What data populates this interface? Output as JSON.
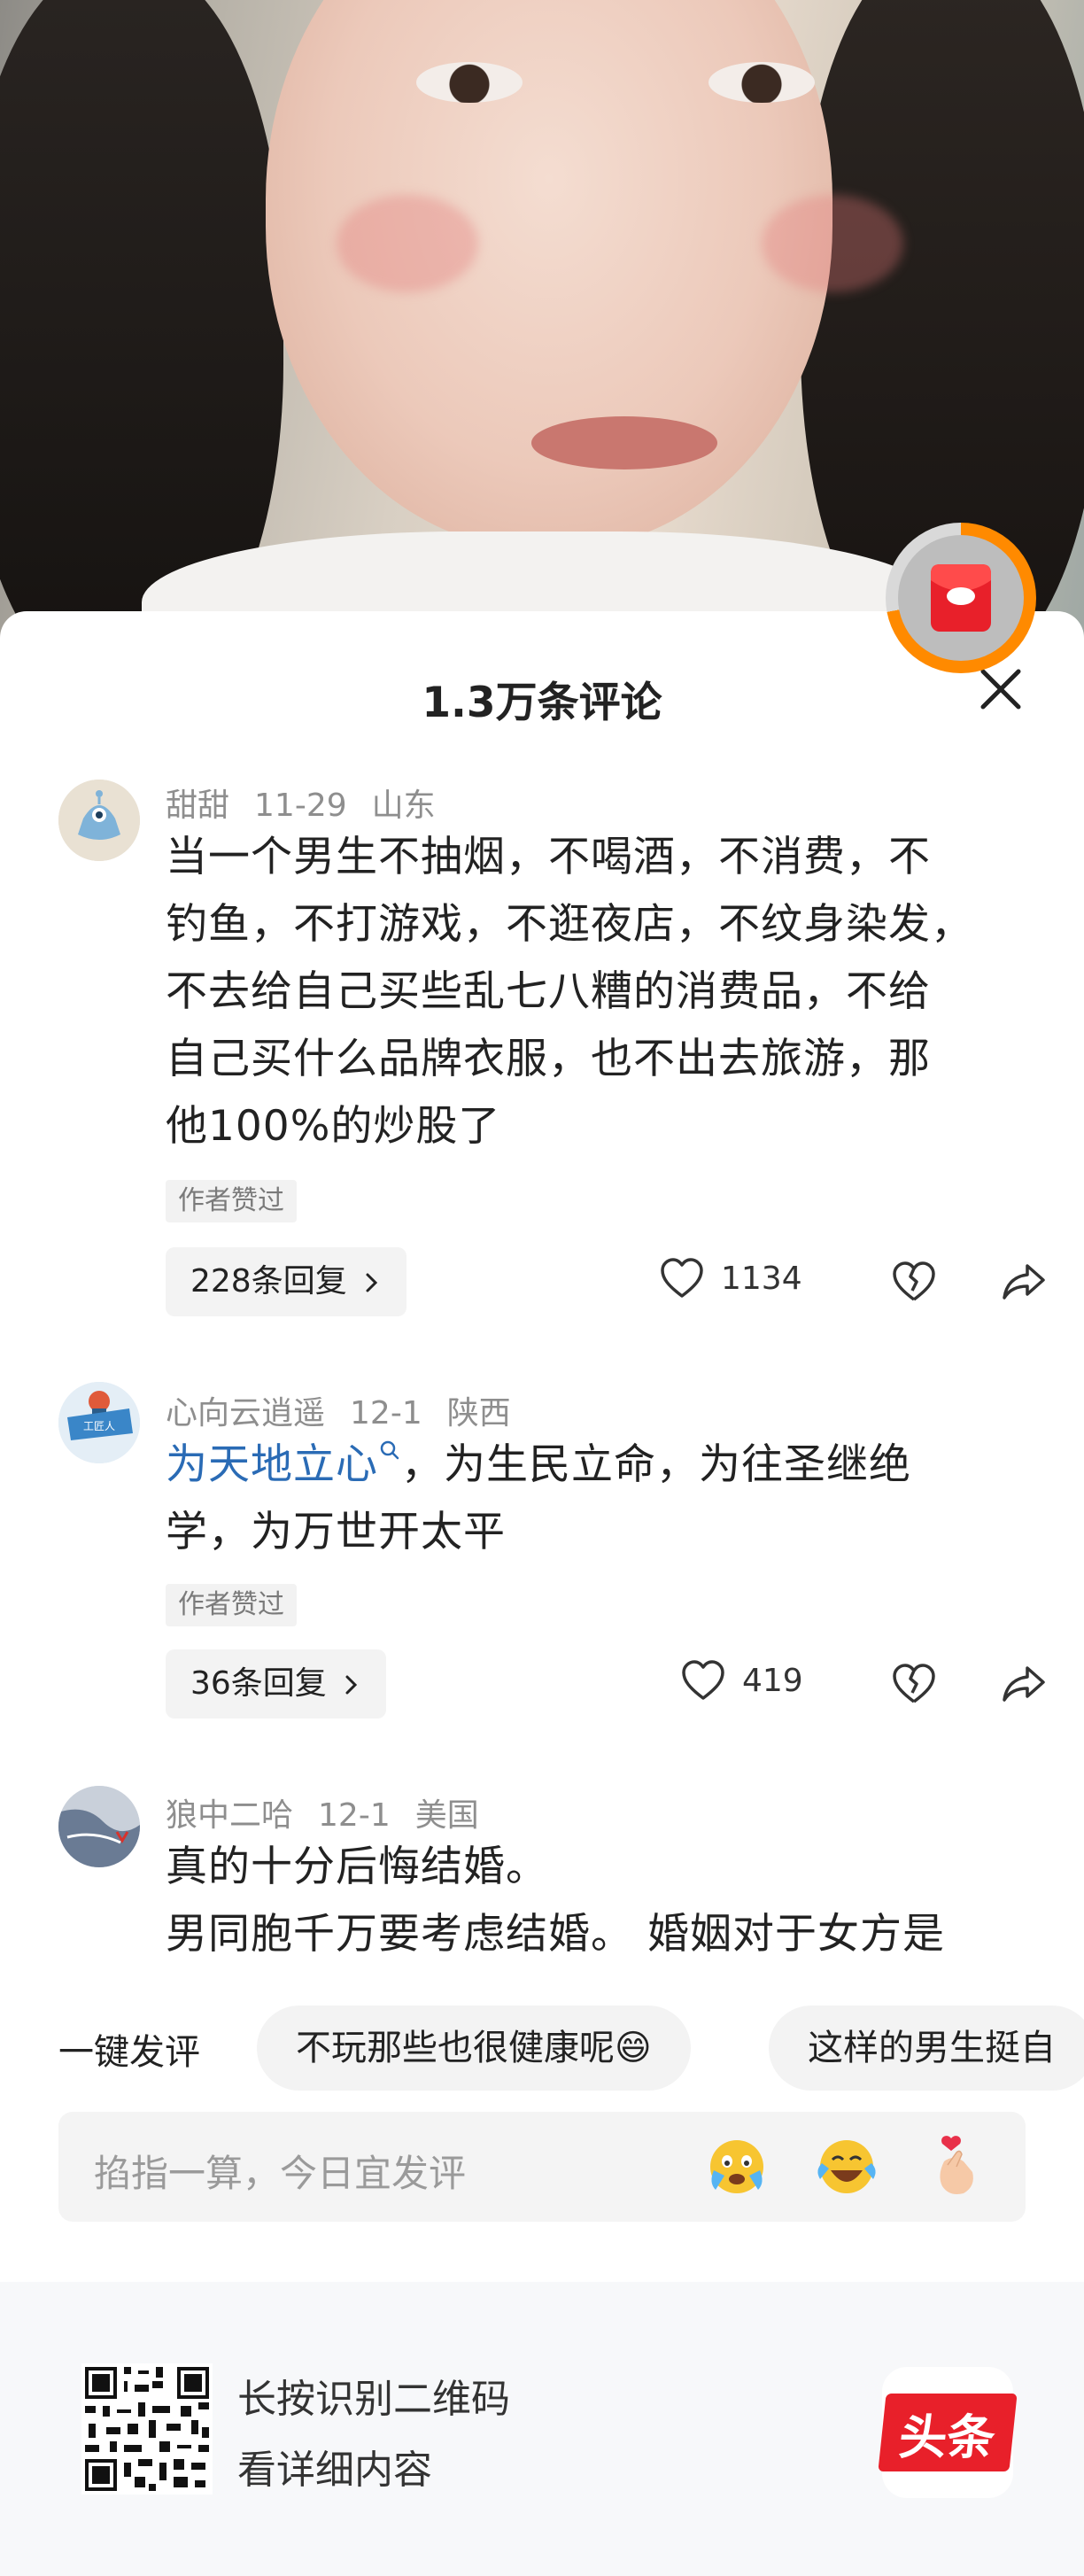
{
  "sheet": {
    "title": "1.3万条评论"
  },
  "comments": [
    {
      "user": "甜甜",
      "date": "11-29",
      "location": "山东",
      "lines": [
        "当一个男生不抽烟，不喝酒，不消费，不",
        "钓鱼，不打游戏，不逛夜店，不纹身染发，",
        "不去给自己买些乱七八糟的消费品，不给",
        "自己买什么品牌衣服，也不出去旅游，那",
        "他100%的炒股了"
      ],
      "badge": "作者赞过",
      "replies": "228条回复",
      "likes": "1134"
    },
    {
      "user": "心向云逍遥",
      "date": "12-1",
      "location": "陕西",
      "link_text": "为天地立心",
      "line1_rest": "，为生民立命，为往圣继绝",
      "line2": "学，为万世开太平",
      "badge": "作者赞过",
      "replies": "36条回复",
      "likes": "419",
      "avatar_text": "工匠人"
    },
    {
      "user": "狼中二哈",
      "date": "12-1",
      "location": "美国",
      "lines": [
        "真的十分后悔结婚。",
        "男同胞千万要考虑结婚。 婚姻对于女方是"
      ]
    }
  ],
  "quick_comment": {
    "label": "一键发评",
    "chips": [
      "不玩那些也很健康呢😄",
      "这样的男生挺自"
    ]
  },
  "input": {
    "placeholder": "掐指一算，今日宜发评"
  },
  "footer": {
    "line1": "长按识别二维码",
    "line2": "看详细内容",
    "app_name": "头条"
  },
  "icons": {
    "reply_chevron": "chevron-right-icon",
    "like": "heart-outline-icon",
    "dislike": "broken-heart-icon",
    "share": "share-arrow-icon",
    "close": "close-icon",
    "red_packet": "red-envelope-icon"
  },
  "colors": {
    "accent_link": "#2a6bb5",
    "progress_ring": "#ff8a00",
    "brand_red": "#e8202a"
  }
}
